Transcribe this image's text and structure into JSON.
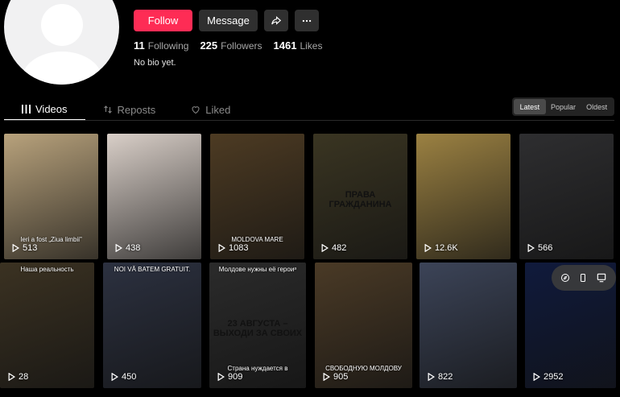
{
  "profile": {
    "follow_label": "Follow",
    "message_label": "Message",
    "stats": [
      {
        "value": "11",
        "label": "Following"
      },
      {
        "value": "225",
        "label": "Followers"
      },
      {
        "value": "1461",
        "label": "Likes"
      }
    ],
    "bio": "No bio yet."
  },
  "tabs": [
    {
      "label": "Videos",
      "icon": "grid-icon",
      "active": true
    },
    {
      "label": "Reposts",
      "icon": "repost-icon",
      "active": false
    },
    {
      "label": "Liked",
      "icon": "heart-icon",
      "active": false
    }
  ],
  "sort": [
    {
      "label": "Latest",
      "active": true
    },
    {
      "label": "Popular",
      "active": false
    },
    {
      "label": "Oldest",
      "active": false
    }
  ],
  "videos": [
    {
      "views": "513",
      "caption_bottom": "Ieri a fost „Ziua limbii”",
      "bg": "#b8a27c"
    },
    {
      "views": "438",
      "caption_bottom": "",
      "bg": "#d9cfc8"
    },
    {
      "views": "1083",
      "caption_bottom": "MOLDOVA MARE",
      "bg": "#4d3b23"
    },
    {
      "views": "482",
      "caption_mid": "ПРАВА ГРАЖДАНИНА",
      "bg": "#3a3522"
    },
    {
      "views": "12.6K",
      "caption_bottom": "",
      "bg": "#9b8142"
    },
    {
      "views": "566",
      "caption_bottom": "",
      "bg": "#2e2e30"
    },
    {
      "views": "28",
      "caption_top": "Наша реальность",
      "bg": "#3b3222"
    },
    {
      "views": "450",
      "caption_top": "NOI VĂ BATEM GRATUIT.",
      "bg": "#2c3140"
    },
    {
      "views": "909",
      "caption_top": "Молдове нужны её героиᵊ",
      "caption_mid": "23 АВГУСТА – ВЫХОДИ ЗА СВОИХ",
      "caption_bottom": "Страна нуждается в",
      "bg": "#2b2b2b"
    },
    {
      "views": "905",
      "caption_bottom": "СВОБОДНУЮ МОЛДОВУ",
      "bg": "#4a3a26"
    },
    {
      "views": "822",
      "caption_bottom": "",
      "bg": "#3c4458"
    },
    {
      "views": "2952",
      "caption_bottom": "",
      "bg": "#101a3c"
    }
  ],
  "colors": {
    "accent": "#fe2c55"
  }
}
